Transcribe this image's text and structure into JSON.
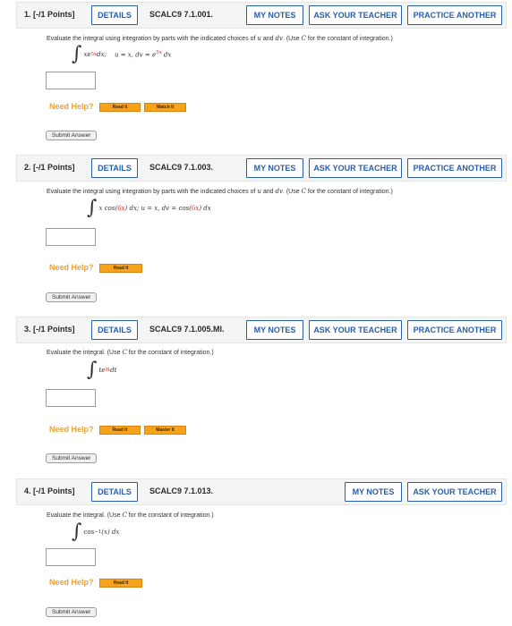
{
  "questions": [
    {
      "number": "1.",
      "points": "[-/1 Points]",
      "details_label": "DETAILS",
      "code": "SCALC9 7.1.001.",
      "my_notes_label": "MY NOTES",
      "ask_teacher_label": "ASK YOUR TEACHER",
      "practice_label": "PRACTICE ANOTHER",
      "prompt_before": "Evaluate the integral using integration by parts with the indicated choices of ",
      "prompt_u": "u",
      "prompt_and": " and ",
      "prompt_dv": "dv",
      "prompt_after": ". (Use ",
      "prompt_C": "C",
      "prompt_end": " for the constant of integration.)",
      "math": {
        "integral": "∫",
        "x": "xe",
        "exp": "5x",
        "dx": " dx;",
        "choice": "u = x,  dv = e",
        "choice_exp": "5x",
        "choice_end": " dx"
      },
      "need_help": "Need Help?",
      "help_buttons": [
        "Read It",
        "Watch It"
      ],
      "submit_label": "Submit Answer"
    },
    {
      "number": "2.",
      "points": "[-/1 Points]",
      "details_label": "DETAILS",
      "code": "SCALC9 7.1.003.",
      "my_notes_label": "MY NOTES",
      "ask_teacher_label": "ASK YOUR TEACHER",
      "practice_label": "PRACTICE ANOTHER",
      "prompt_before": "Evaluate the integral using integration by parts with the indicated choices of ",
      "prompt_u": "u",
      "prompt_and": " and ",
      "prompt_dv": "dv",
      "prompt_after": ". (Use ",
      "prompt_C": "C",
      "prompt_end": " for the constant of integration.)",
      "math": {
        "integral": "∫",
        "pre": "x cos(",
        "arg": "6x",
        "post": ") dx;   u = x,  dv = cos(",
        "arg2": "6x",
        "end": ") dx"
      },
      "need_help": "Need Help?",
      "help_buttons": [
        "Read It"
      ],
      "submit_label": "Submit Answer"
    },
    {
      "number": "3.",
      "points": "[-/1 Points]",
      "details_label": "DETAILS",
      "code": "SCALC9 7.1.005.MI.",
      "my_notes_label": "MY NOTES",
      "ask_teacher_label": "ASK YOUR TEACHER",
      "practice_label": "PRACTICE ANOTHER",
      "prompt_before": "Evaluate the integral. (Use ",
      "prompt_C": "C",
      "prompt_end": " for the constant of integration.)",
      "math": {
        "integral": "∫",
        "base": "te",
        "exp": "8t",
        "end": " dt"
      },
      "need_help": "Need Help?",
      "help_buttons": [
        "Read It",
        "Master It"
      ],
      "submit_label": "Submit Answer"
    },
    {
      "number": "4.",
      "points": "[-/1 Points]",
      "details_label": "DETAILS",
      "code": "SCALC9 7.1.013.",
      "my_notes_label": "MY NOTES",
      "ask_teacher_label": "ASK YOUR TEACHER",
      "prompt_before": "Evaluate the integral. (Use ",
      "prompt_C": "C",
      "prompt_end": " for the constant of integration.)",
      "math": {
        "integral": "∫",
        "func": "cos",
        "exp": "−1",
        "arg": "(x) dx"
      },
      "need_help": "Need Help?",
      "help_buttons": [
        "Read It"
      ],
      "submit_label": "Submit Answer"
    }
  ],
  "colors": {
    "accent": "#2b5ea8",
    "help_orange": "#e8a23a",
    "math_red": "#d43b2e"
  }
}
